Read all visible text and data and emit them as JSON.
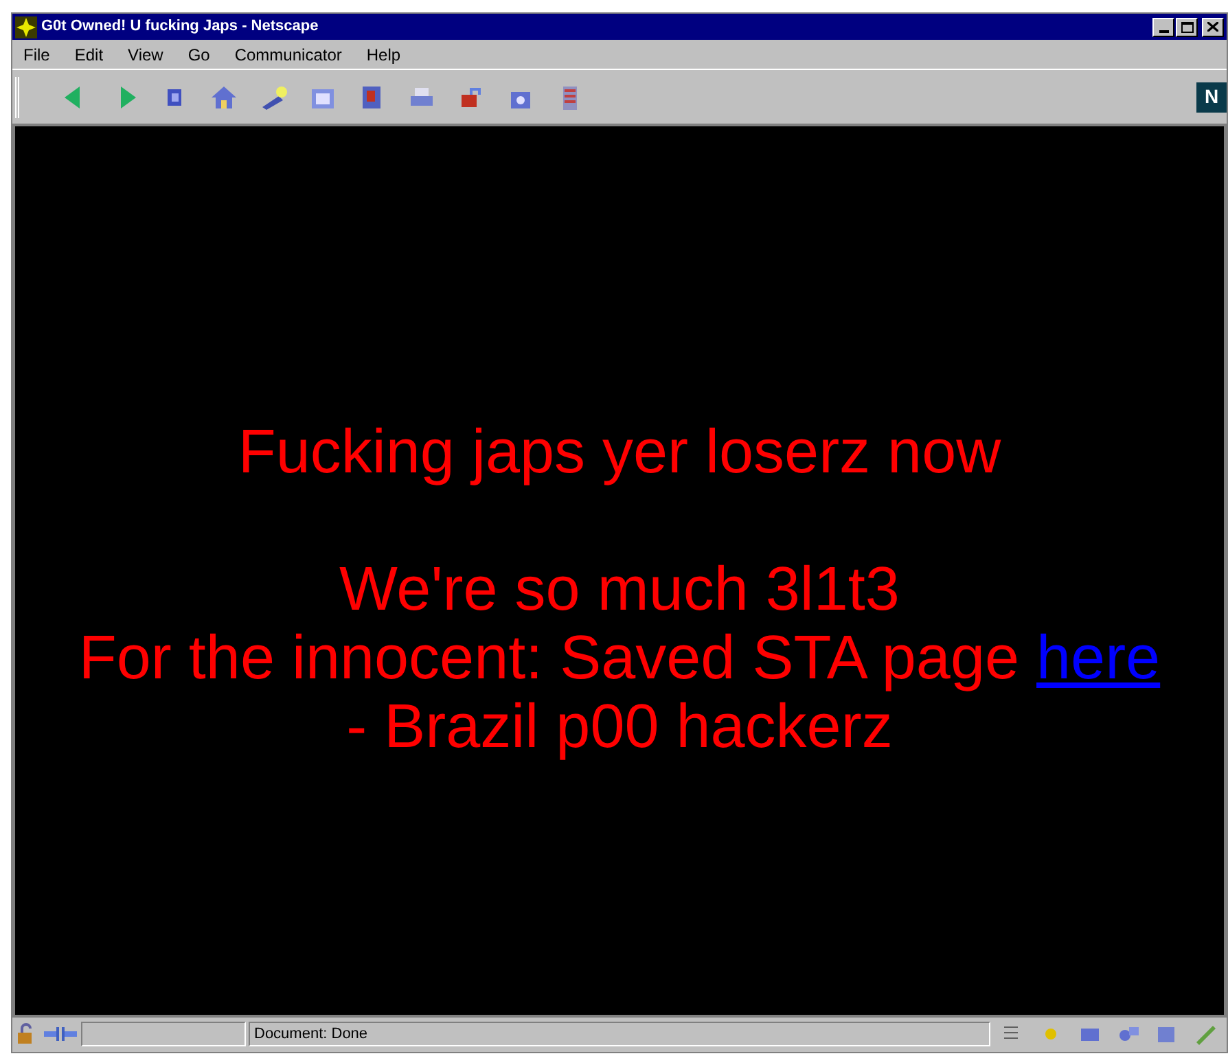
{
  "window": {
    "title": "G0t Owned! U fucking Japs - Netscape"
  },
  "menu": [
    "File",
    "Edit",
    "View",
    "Go",
    "Communicator",
    "Help"
  ],
  "logo": "N",
  "content": {
    "headline": "Fucking japs yer loserz now",
    "lines": [
      {
        "text": "We're so much 3l1t3"
      },
      {
        "text": "For the innocent: Saved STA page ",
        "link": "here"
      },
      {
        "text": "- Brazil p00 hackerz"
      }
    ]
  },
  "status_bar": {
    "text": "Document: Done"
  }
}
